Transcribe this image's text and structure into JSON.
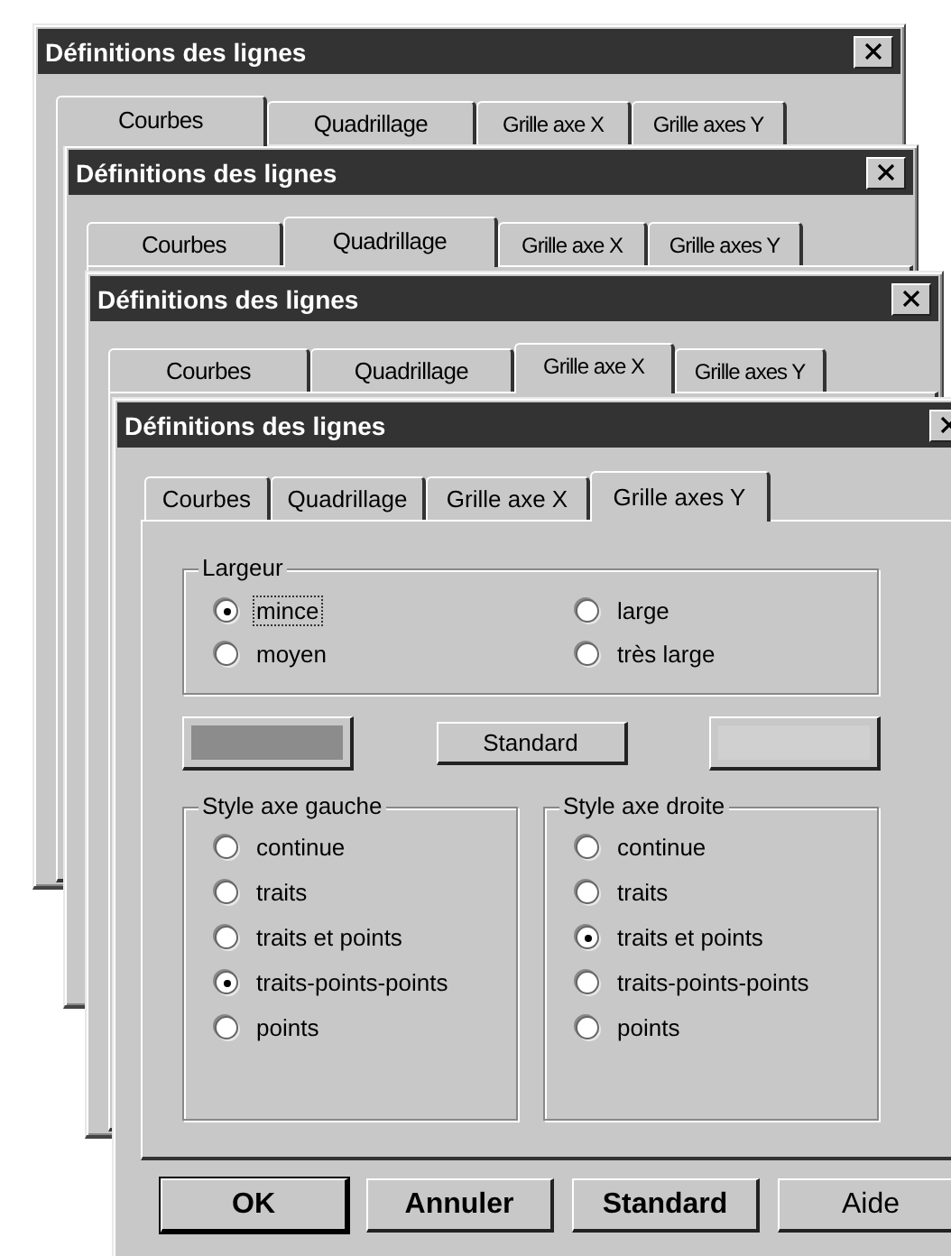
{
  "windows": [
    {
      "title": "Définitions des lignes",
      "tabs": [
        {
          "label": "Courbes",
          "selected": true
        },
        {
          "label": "Quadrillage",
          "selected": false
        },
        {
          "label": "Grille axe X",
          "selected": false
        },
        {
          "label": "Grille axes Y",
          "selected": false
        }
      ]
    },
    {
      "title": "Définitions des lignes",
      "tabs": [
        {
          "label": "Courbes",
          "selected": false
        },
        {
          "label": "Quadrillage",
          "selected": true
        },
        {
          "label": "Grille axe X",
          "selected": false
        },
        {
          "label": "Grille axes Y",
          "selected": false
        }
      ]
    },
    {
      "title": "Définitions des lignes",
      "tabs": [
        {
          "label": "Courbes",
          "selected": false
        },
        {
          "label": "Quadrillage",
          "selected": false
        },
        {
          "label": "Grille axe X",
          "selected": true
        },
        {
          "label": "Grille axes Y",
          "selected": false
        }
      ]
    },
    {
      "title": "Définitions des lignes",
      "tabs": [
        {
          "label": "Courbes",
          "selected": false
        },
        {
          "label": "Quadrillage",
          "selected": false
        },
        {
          "label": "Grille axe X",
          "selected": false
        },
        {
          "label": "Grille axes Y",
          "selected": true
        }
      ],
      "content": {
        "width_group": {
          "label": "Largeur",
          "options": [
            {
              "label": "mince",
              "selected": true,
              "focused": true
            },
            {
              "label": "large",
              "selected": false,
              "focused": false
            },
            {
              "label": "moyen",
              "selected": false,
              "focused": false
            },
            {
              "label": "très large",
              "selected": false,
              "focused": false
            }
          ]
        },
        "swatches": [
          {
            "color": "#8c8c8c"
          },
          {
            "color": "#d0d0d0"
          }
        ],
        "standard_button": "Standard",
        "axis_groups": [
          {
            "label": "Style axe gauche",
            "options": [
              {
                "label": "continue",
                "selected": false
              },
              {
                "label": "traits",
                "selected": false
              },
              {
                "label": "traits et points",
                "selected": false
              },
              {
                "label": "traits-points-points",
                "selected": true
              },
              {
                "label": "points",
                "selected": false
              }
            ]
          },
          {
            "label": "Style axe droite",
            "options": [
              {
                "label": "continue",
                "selected": false
              },
              {
                "label": "traits",
                "selected": false
              },
              {
                "label": "traits et points",
                "selected": true
              },
              {
                "label": "traits-points-points",
                "selected": false
              },
              {
                "label": "points",
                "selected": false
              }
            ]
          }
        ],
        "buttons": [
          {
            "label": "OK",
            "default": true,
            "bold": true
          },
          {
            "label": "Annuler",
            "default": false,
            "bold": true
          },
          {
            "label": "Standard",
            "default": false,
            "bold": true
          },
          {
            "label": "Aide",
            "default": false,
            "bold": false
          }
        ]
      }
    }
  ]
}
